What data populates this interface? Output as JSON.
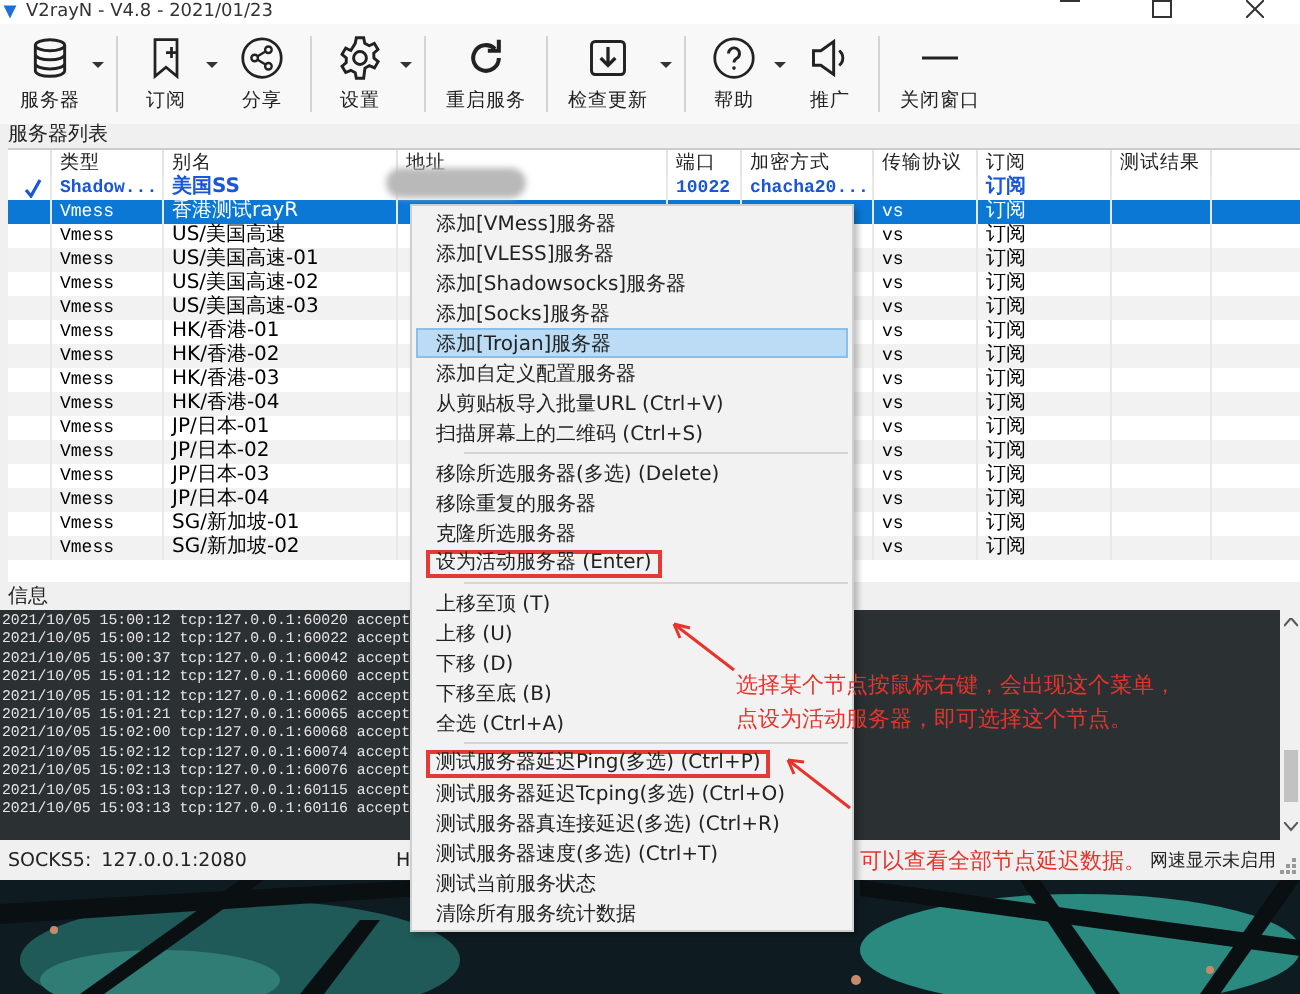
{
  "window": {
    "title": "V2rayN - V4.8 - 2021/01/23"
  },
  "toolbar": [
    {
      "label": "服务器",
      "has_dropdown": true,
      "separator_before": false
    },
    {
      "label": "订阅",
      "has_dropdown": true,
      "separator_before": true
    },
    {
      "label": "分享",
      "has_dropdown": false,
      "separator_before": false
    },
    {
      "label": "设置",
      "has_dropdown": true,
      "separator_before": true
    },
    {
      "label": "重启服务",
      "has_dropdown": false,
      "separator_before": true
    },
    {
      "label": "检查更新",
      "has_dropdown": true,
      "separator_before": true
    },
    {
      "label": "帮助",
      "has_dropdown": true,
      "separator_before": true
    },
    {
      "label": "推广",
      "has_dropdown": false,
      "separator_before": false
    },
    {
      "label": "关闭窗口",
      "has_dropdown": false,
      "separator_before": true
    }
  ],
  "server_list": {
    "title": "服务器列表",
    "columns": [
      "类型",
      "别名",
      "地址",
      "端口",
      "加密方式",
      "传输协议",
      "订阅",
      "测试结果"
    ],
    "rows": [
      {
        "type": "Shadow...",
        "alias": "美国SS",
        "address_blurred": true,
        "port": "10022",
        "security": "chacha20...",
        "network": "",
        "subscription": "订阅",
        "active": true,
        "selected": false
      },
      {
        "type": "Vmess",
        "alias": "香港测试rayR",
        "address_blurred": false,
        "port": "",
        "security": "",
        "network": "vs",
        "subscription": "订阅",
        "active": false,
        "selected": true
      },
      {
        "type": "Vmess",
        "alias": "US/美国高速",
        "address_blurred": false,
        "port": "",
        "security": "",
        "network": "vs",
        "subscription": "订阅",
        "active": false,
        "selected": false
      },
      {
        "type": "Vmess",
        "alias": "US/美国高速-01",
        "address_blurred": false,
        "port": "",
        "security": "",
        "network": "vs",
        "subscription": "订阅",
        "active": false,
        "selected": false
      },
      {
        "type": "Vmess",
        "alias": "US/美国高速-02",
        "address_blurred": false,
        "port": "",
        "security": "",
        "network": "vs",
        "subscription": "订阅",
        "active": false,
        "selected": false
      },
      {
        "type": "Vmess",
        "alias": "US/美国高速-03",
        "address_blurred": false,
        "port": "",
        "security": "",
        "network": "vs",
        "subscription": "订阅",
        "active": false,
        "selected": false
      },
      {
        "type": "Vmess",
        "alias": "HK/香港-01",
        "address_blurred": false,
        "port": "",
        "security": "",
        "network": "vs",
        "subscription": "订阅",
        "active": false,
        "selected": false
      },
      {
        "type": "Vmess",
        "alias": "HK/香港-02",
        "address_blurred": false,
        "port": "",
        "security": "",
        "network": "vs",
        "subscription": "订阅",
        "active": false,
        "selected": false
      },
      {
        "type": "Vmess",
        "alias": "HK/香港-03",
        "address_blurred": false,
        "port": "",
        "security": "",
        "network": "vs",
        "subscription": "订阅",
        "active": false,
        "selected": false
      },
      {
        "type": "Vmess",
        "alias": "HK/香港-04",
        "address_blurred": false,
        "port": "",
        "security": "",
        "network": "vs",
        "subscription": "订阅",
        "active": false,
        "selected": false
      },
      {
        "type": "Vmess",
        "alias": "JP/日本-01",
        "address_blurred": false,
        "port": "",
        "security": "",
        "network": "vs",
        "subscription": "订阅",
        "active": false,
        "selected": false
      },
      {
        "type": "Vmess",
        "alias": "JP/日本-02",
        "address_blurred": false,
        "port": "",
        "security": "",
        "network": "vs",
        "subscription": "订阅",
        "active": false,
        "selected": false
      },
      {
        "type": "Vmess",
        "alias": "JP/日本-03",
        "address_blurred": false,
        "port": "",
        "security": "",
        "network": "vs",
        "subscription": "订阅",
        "active": false,
        "selected": false
      },
      {
        "type": "Vmess",
        "alias": "JP/日本-04",
        "address_blurred": false,
        "port": "",
        "security": "",
        "network": "vs",
        "subscription": "订阅",
        "active": false,
        "selected": false
      },
      {
        "type": "Vmess",
        "alias": "SG/新加坡-01",
        "address_blurred": false,
        "port": "",
        "security": "",
        "network": "vs",
        "subscription": "订阅",
        "active": false,
        "selected": false
      },
      {
        "type": "Vmess",
        "alias": "SG/新加坡-02",
        "address_blurred": false,
        "port": "",
        "security": "",
        "network": "vs",
        "subscription": "订阅",
        "active": false,
        "selected": false
      }
    ]
  },
  "info": {
    "title": "信息",
    "log_lines": [
      "2021/10/05 15:00:12 tcp:127.0.0.1:60020 accept",
      "2021/10/05 15:00:12 tcp:127.0.0.1:60022 accept",
      "2021/10/05 15:00:37 tcp:127.0.0.1:60042 accept",
      "2021/10/05 15:01:12 tcp:127.0.0.1:60060 accept",
      "2021/10/05 15:01:12 tcp:127.0.0.1:60062 accept",
      "2021/10/05 15:01:21 tcp:127.0.0.1:60065 accept",
      "2021/10/05 15:02:00 tcp:127.0.0.1:60068 accept",
      "2021/10/05 15:02:12 tcp:127.0.0.1:60074 accept",
      "2021/10/05 15:02:13 tcp:127.0.0.1:60076 accept",
      "2021/10/05 15:03:13 tcp:127.0.0.1:60115 accept",
      "2021/10/05 15:03:13 tcp:127.0.0.1:60116 accept"
    ]
  },
  "status_bar": {
    "socks_label": "SOCKS5:",
    "socks_address": "127.0.0.1:2080",
    "partial": "H",
    "speed_status": "网速显示未启用"
  },
  "context_menu": [
    {
      "label": "添加[VMess]服务器",
      "selected": false,
      "boxed": false,
      "separator_before": false
    },
    {
      "label": "添加[VLESS]服务器",
      "selected": false,
      "boxed": false,
      "separator_before": false
    },
    {
      "label": "添加[Shadowsocks]服务器",
      "selected": false,
      "boxed": false,
      "separator_before": false
    },
    {
      "label": "添加[Socks]服务器",
      "selected": false,
      "boxed": false,
      "separator_before": false
    },
    {
      "label": "添加[Trojan]服务器",
      "selected": true,
      "boxed": false,
      "separator_before": false
    },
    {
      "label": "添加自定义配置服务器",
      "selected": false,
      "boxed": false,
      "separator_before": false
    },
    {
      "label": "从剪贴板导入批量URL (Ctrl+V)",
      "selected": false,
      "boxed": false,
      "separator_before": false
    },
    {
      "label": "扫描屏幕上的二维码 (Ctrl+S)",
      "selected": false,
      "boxed": false,
      "separator_before": false
    },
    {
      "label": "移除所选服务器(多选) (Delete)",
      "selected": false,
      "boxed": false,
      "separator_before": true
    },
    {
      "label": "移除重复的服务器",
      "selected": false,
      "boxed": false,
      "separator_before": false
    },
    {
      "label": "克隆所选服务器",
      "selected": false,
      "boxed": false,
      "separator_before": false
    },
    {
      "label": "设为活动服务器 (Enter)",
      "selected": false,
      "boxed": true,
      "separator_before": false
    },
    {
      "label": "上移至顶 (T)",
      "selected": false,
      "boxed": false,
      "separator_before": true
    },
    {
      "label": "上移 (U)",
      "selected": false,
      "boxed": false,
      "separator_before": false
    },
    {
      "label": "下移 (D)",
      "selected": false,
      "boxed": false,
      "separator_before": false
    },
    {
      "label": "下移至底 (B)",
      "selected": false,
      "boxed": false,
      "separator_before": false
    },
    {
      "label": "全选 (Ctrl+A)",
      "selected": false,
      "boxed": false,
      "separator_before": false
    },
    {
      "label": "测试服务器延迟Ping(多选) (Ctrl+P)",
      "selected": false,
      "boxed": true,
      "separator_before": true
    },
    {
      "label": "测试服务器延迟Tcping(多选) (Ctrl+O)",
      "selected": false,
      "boxed": false,
      "separator_before": false
    },
    {
      "label": "测试服务器真连接延迟(多选) (Ctrl+R)",
      "selected": false,
      "boxed": false,
      "separator_before": false
    },
    {
      "label": "测试服务器速度(多选) (Ctrl+T)",
      "selected": false,
      "boxed": false,
      "separator_before": false
    },
    {
      "label": "测试当前服务状态",
      "selected": false,
      "boxed": false,
      "separator_before": false
    },
    {
      "label": "清除所有服务统计数据",
      "selected": false,
      "boxed": false,
      "separator_before": false
    }
  ],
  "annotations": [
    {
      "lines": [
        "选择某个节点按鼠标右键，会出现这个菜单，",
        "点设为活动服务器，即可选择这个节点。"
      ]
    },
    {
      "lines": [
        "可以查看全部节点延迟数据。"
      ]
    }
  ]
}
